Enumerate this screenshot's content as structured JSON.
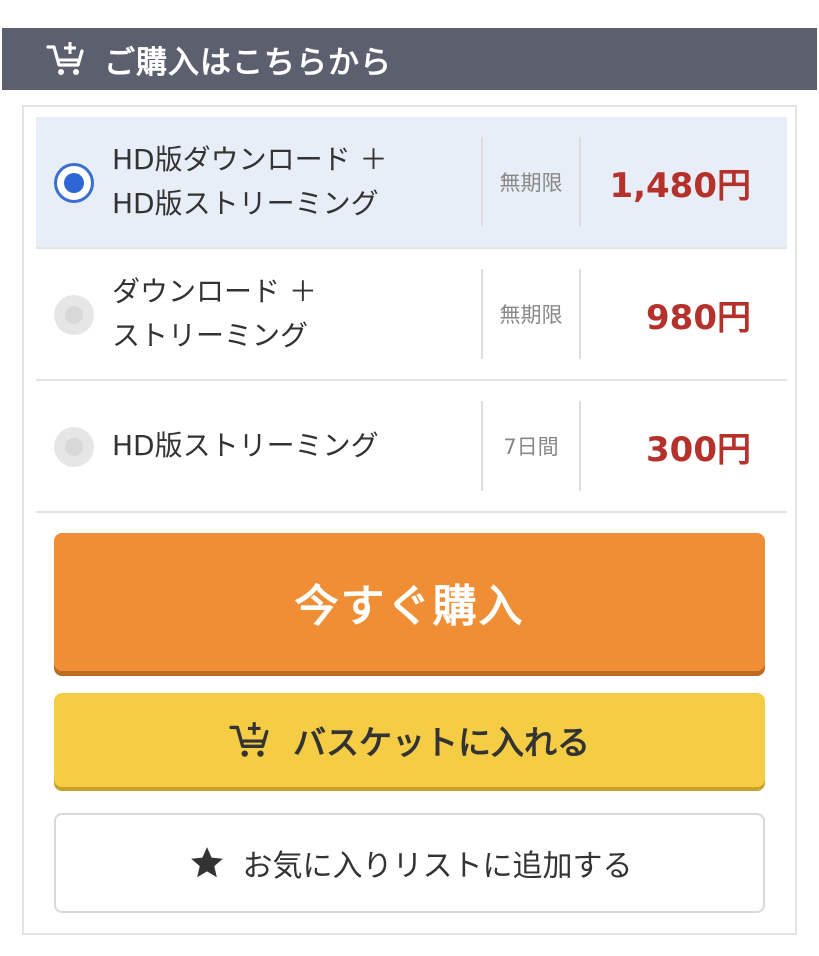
{
  "header": {
    "title": "ご購入はこちらから",
    "icon": "cart-add-icon"
  },
  "options": [
    {
      "line1": "HD版ダウンロード ＋",
      "line2": "HD版ストリーミング",
      "period": "無期限",
      "price": "1,480円",
      "selected": true
    },
    {
      "line1": "ダウンロード ＋",
      "line2": "ストリーミング",
      "period": "無期限",
      "price": "980円",
      "selected": false
    },
    {
      "line1": "HD版ストリーミング",
      "line2": "",
      "period": "7日間",
      "price": "300円",
      "selected": false
    }
  ],
  "buttons": {
    "buy_now": "今すぐ購入",
    "add_to_basket": "バスケットに入れる",
    "add_to_favorites": "お気に入りリストに追加する"
  },
  "colors": {
    "header_bg": "#5b5f6e",
    "selected_bg": "#e8eef7",
    "price": "#b5312b",
    "buy_button": "#ef8e35",
    "basket_button": "#f5cd45",
    "radio_selected": "#2e66d6"
  }
}
